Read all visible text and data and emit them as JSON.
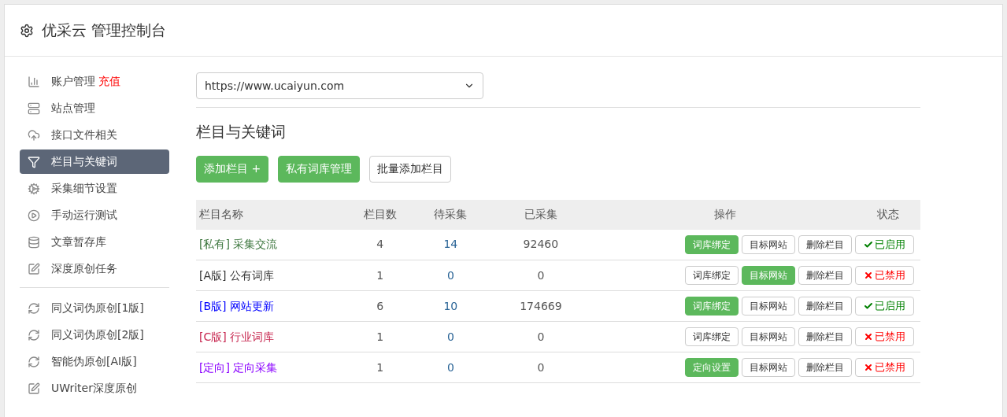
{
  "header": {
    "title": "优采云 管理控制台"
  },
  "sidebar": {
    "groups": [
      {
        "items": [
          {
            "label": "账户管理",
            "badge": "充值",
            "selected": false
          },
          {
            "label": "站点管理",
            "selected": false
          },
          {
            "label": "接口文件相关",
            "selected": false
          },
          {
            "label": "栏目与关键词",
            "selected": true
          },
          {
            "label": "采集细节设置",
            "selected": false
          },
          {
            "label": "手动运行测试",
            "selected": false
          },
          {
            "label": "文章暂存库",
            "selected": false
          },
          {
            "label": "深度原创任务",
            "selected": false
          }
        ]
      },
      {
        "items": [
          {
            "label": "同义词伪原创[1版]",
            "selected": false
          },
          {
            "label": "同义词伪原创[2版]",
            "selected": false
          },
          {
            "label": "智能伪原创[AI版]",
            "selected": false
          },
          {
            "label": "UWriter深度原创",
            "selected": false
          }
        ]
      }
    ]
  },
  "site_select": {
    "value": "https://www.ucaiyun.com"
  },
  "section_title": "栏目与关键词",
  "toolbar": [
    {
      "label": "添加栏目 +",
      "primary": true
    },
    {
      "label": "私有词库管理",
      "primary": true
    },
    {
      "label": "批量添加栏目",
      "primary": false
    }
  ],
  "table": {
    "columns": [
      "栏目名称",
      "栏目数",
      "待采集",
      "已采集",
      "操作",
      "状态"
    ],
    "rows": [
      {
        "tag": "[私有]",
        "name": "采集交流",
        "color": "#3c763d",
        "count": "4",
        "pending": "14",
        "collected": "92460",
        "actions": [
          {
            "label": "词库绑定",
            "primary": true
          },
          {
            "label": "目标网站",
            "primary": false
          },
          {
            "label": "删除栏目",
            "primary": false
          }
        ],
        "status": "已启用",
        "enabled": true
      },
      {
        "tag": "[A版]",
        "name": "公有词库",
        "color": "#333333",
        "count": "1",
        "pending": "0",
        "collected": "0",
        "actions": [
          {
            "label": "词库绑定",
            "primary": false
          },
          {
            "label": "目标网站",
            "primary": true
          },
          {
            "label": "删除栏目",
            "primary": false
          }
        ],
        "status": "已禁用",
        "enabled": false
      },
      {
        "tag": "[B版]",
        "name": "网站更新",
        "color": "#0000ff",
        "count": "6",
        "pending": "10",
        "collected": "174669",
        "actions": [
          {
            "label": "词库绑定",
            "primary": true
          },
          {
            "label": "目标网站",
            "primary": false
          },
          {
            "label": "删除栏目",
            "primary": false
          }
        ],
        "status": "已启用",
        "enabled": true
      },
      {
        "tag": "[C版]",
        "name": "行业词库",
        "color": "#c7254e",
        "count": "1",
        "pending": "0",
        "collected": "0",
        "actions": [
          {
            "label": "词库绑定",
            "primary": false
          },
          {
            "label": "目标网站",
            "primary": false
          },
          {
            "label": "删除栏目",
            "primary": false
          }
        ],
        "status": "已禁用",
        "enabled": false
      },
      {
        "tag": "[定向]",
        "name": "定向采集",
        "color": "#8a00ff",
        "count": "1",
        "pending": "0",
        "collected": "0",
        "actions": [
          {
            "label": "定向设置",
            "primary": true
          },
          {
            "label": "目标网站",
            "primary": false
          },
          {
            "label": "删除栏目",
            "primary": false
          }
        ],
        "status": "已禁用",
        "enabled": false
      }
    ]
  }
}
